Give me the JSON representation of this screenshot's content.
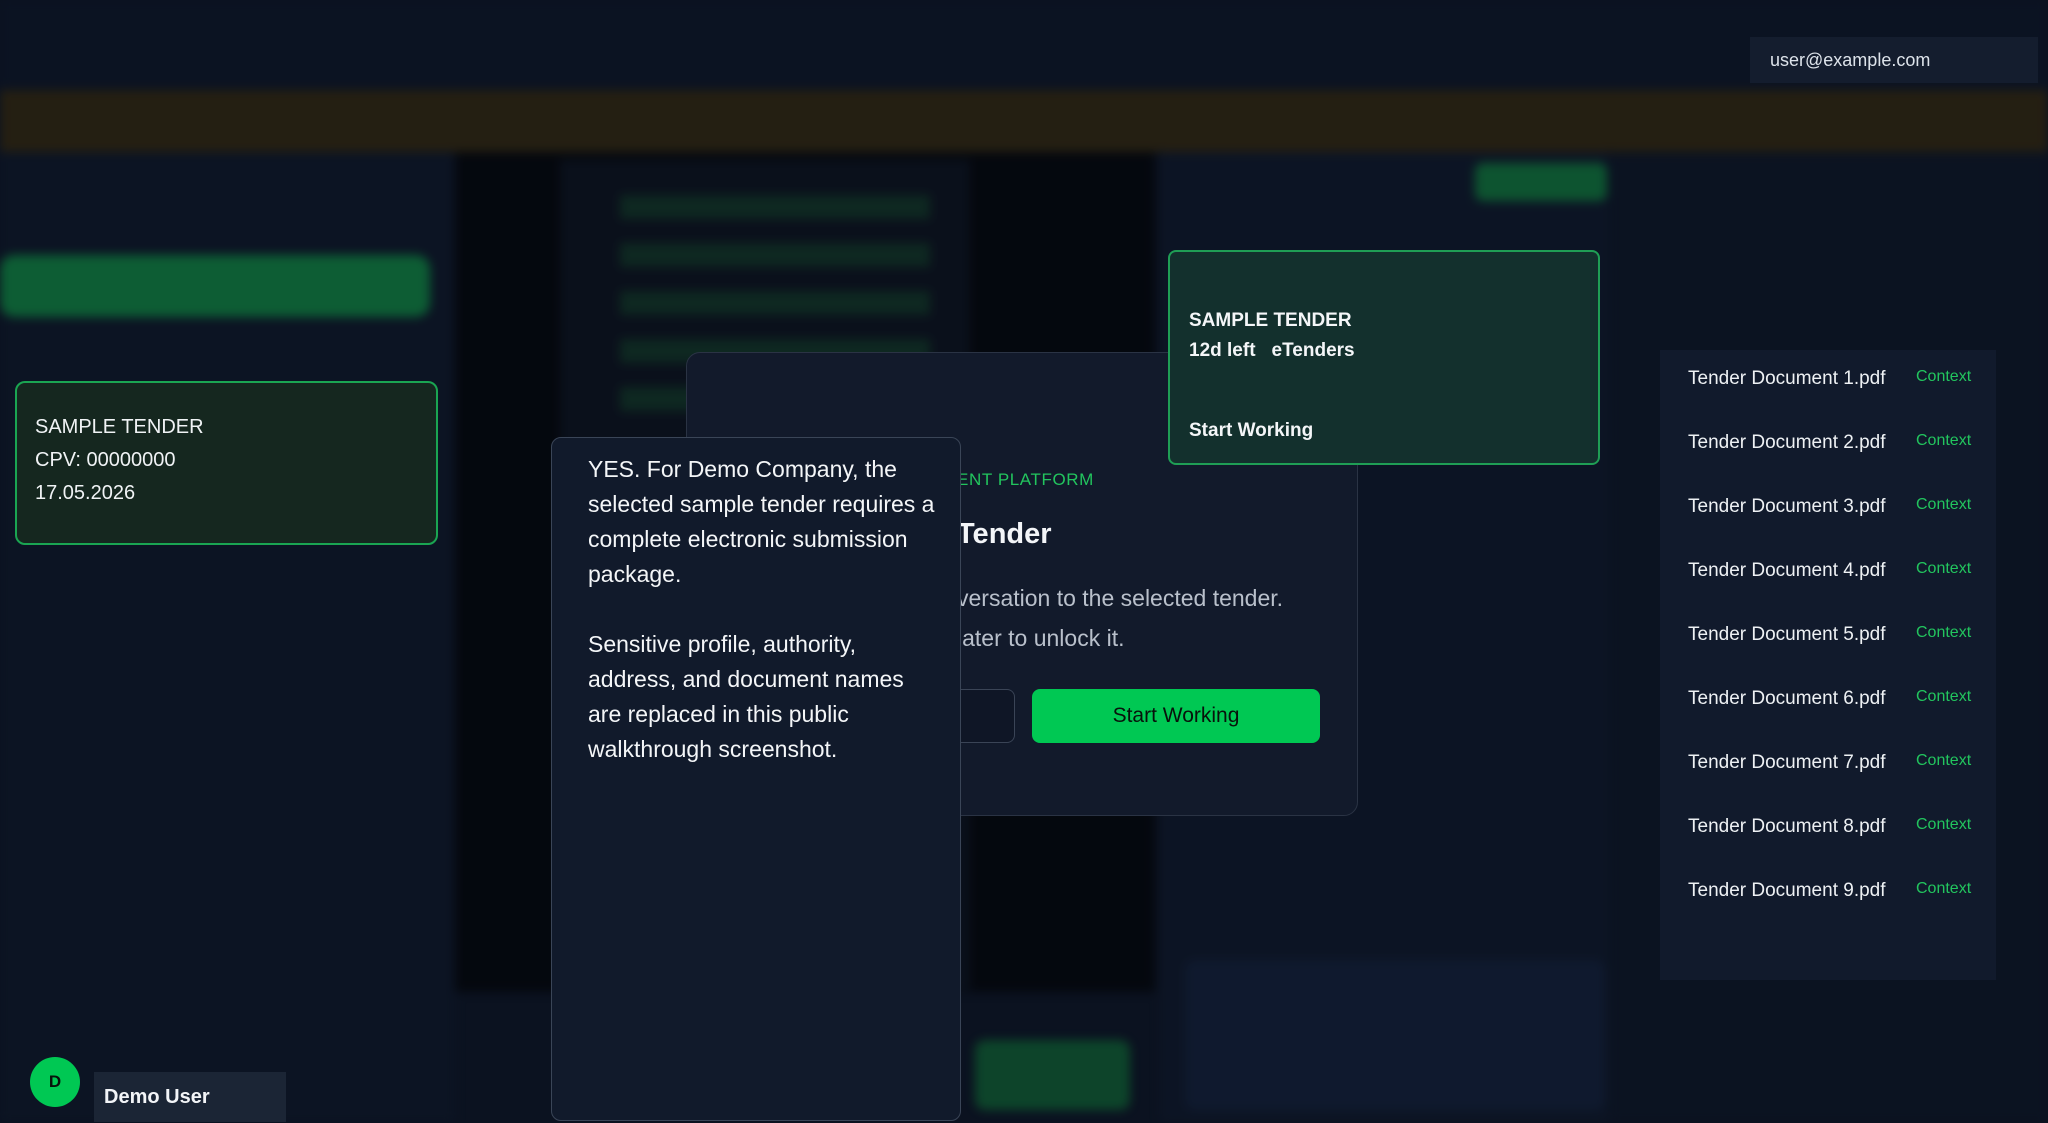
{
  "header": {
    "user_email": "user@example.com"
  },
  "sidebar": {
    "tender_card": {
      "title": "SAMPLE TENDER",
      "cpv": "CPV: 00000000",
      "date": "17.05.2026"
    }
  },
  "modal": {
    "kicker": "ENT PLATFORM",
    "title": "Tender",
    "description_line1": "versation to the selected tender.",
    "description_line2": "later to unlock it.",
    "start_button": "Start Working"
  },
  "chat": {
    "paragraph1": "YES. For Demo Company, the selected sample tender requires a complete electronic submission package.",
    "paragraph2": "Sensitive profile, authority, address, and document names are replaced in this public walkthrough screenshot."
  },
  "tender_popup": {
    "title": "SAMPLE TENDER",
    "days_left": "12d left",
    "source": "eTenders",
    "action": "Start Working"
  },
  "documents": {
    "items": [
      {
        "name": "Tender Document 1.pdf",
        "tag": "Context"
      },
      {
        "name": "Tender Document 2.pdf",
        "tag": "Context"
      },
      {
        "name": "Tender Document 3.pdf",
        "tag": "Context"
      },
      {
        "name": "Tender Document 4.pdf",
        "tag": "Context"
      },
      {
        "name": "Tender Document 5.pdf",
        "tag": "Context"
      },
      {
        "name": "Tender Document 6.pdf",
        "tag": "Context"
      },
      {
        "name": "Tender Document 7.pdf",
        "tag": "Context"
      },
      {
        "name": "Tender Document 8.pdf",
        "tag": "Context"
      },
      {
        "name": "Tender Document 9.pdf",
        "tag": "Context"
      }
    ]
  },
  "user": {
    "initial": "D",
    "name": "Demo User"
  }
}
